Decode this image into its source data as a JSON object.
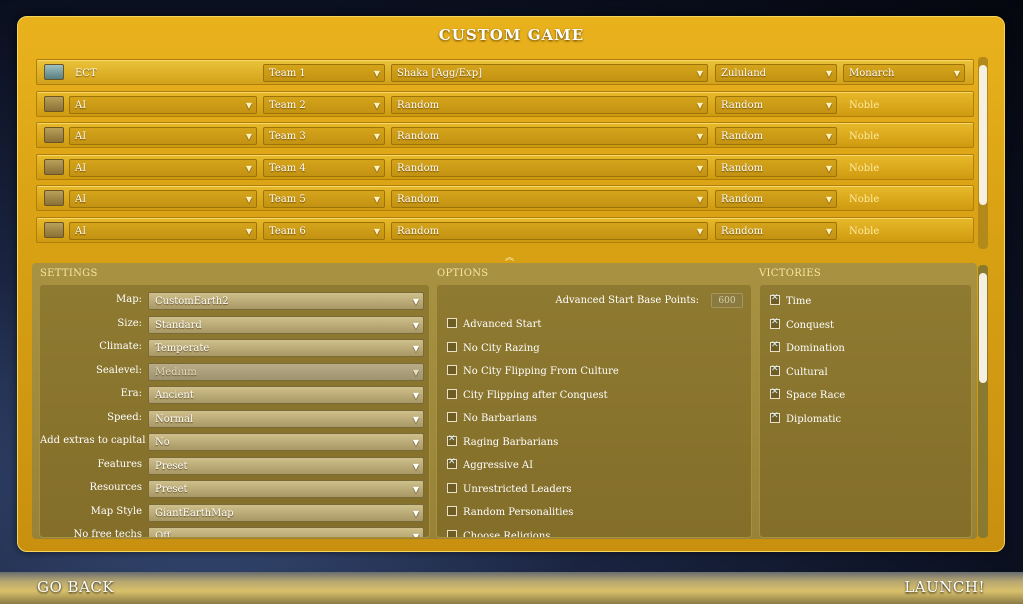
{
  "title": "CUSTOM GAME",
  "nav": {
    "back": "GO BACK",
    "launch": "LAUNCH!"
  },
  "players": [
    {
      "name": "ECT",
      "team": "Team 1",
      "leader": "Shaka [Agg/Exp]",
      "civ": "Zululand",
      "difficulty": "Monarch",
      "active": true
    },
    {
      "name": "AI",
      "team": "Team 2",
      "leader": "Random",
      "civ": "Random",
      "difficulty": "Noble",
      "active": false
    },
    {
      "name": "AI",
      "team": "Team 3",
      "leader": "Random",
      "civ": "Random",
      "difficulty": "Noble",
      "active": false
    },
    {
      "name": "AI",
      "team": "Team 4",
      "leader": "Random",
      "civ": "Random",
      "difficulty": "Noble",
      "active": false
    },
    {
      "name": "AI",
      "team": "Team 5",
      "leader": "Random",
      "civ": "Random",
      "difficulty": "Noble",
      "active": false
    },
    {
      "name": "AI",
      "team": "Team 6",
      "leader": "Random",
      "civ": "Random",
      "difficulty": "Noble",
      "active": false
    }
  ],
  "sections": {
    "settings": "SETTINGS",
    "options": "OPTIONS",
    "victories": "VICTORIES"
  },
  "settings": [
    {
      "label": "Map:",
      "value": "CustomEarth2",
      "disabled": false
    },
    {
      "label": "Size:",
      "value": "Standard",
      "disabled": false
    },
    {
      "label": "Climate:",
      "value": "Temperate",
      "disabled": false
    },
    {
      "label": "Sealevel:",
      "value": "Medium",
      "disabled": true
    },
    {
      "label": "Era:",
      "value": "Ancient",
      "disabled": false
    },
    {
      "label": "Speed:",
      "value": "Normal",
      "disabled": false
    },
    {
      "label": "Add extras to capital",
      "value": "No",
      "disabled": false
    },
    {
      "label": "Features",
      "value": "Preset",
      "disabled": false
    },
    {
      "label": "Resources",
      "value": "Preset",
      "disabled": false
    },
    {
      "label": "Map Style",
      "value": "GiantEarthMap",
      "disabled": false
    },
    {
      "label": "No free techs",
      "value": "Off",
      "disabled": false
    }
  ],
  "advanced_start": {
    "label": "Advanced Start Base Points:",
    "value": "600"
  },
  "options": [
    {
      "label": "Advanced Start",
      "checked": false
    },
    {
      "label": "No City Razing",
      "checked": false
    },
    {
      "label": "No City Flipping From Culture",
      "checked": false
    },
    {
      "label": "City Flipping after Conquest",
      "checked": false
    },
    {
      "label": "No Barbarians",
      "checked": false
    },
    {
      "label": "Raging Barbarians",
      "checked": true
    },
    {
      "label": "Aggressive AI",
      "checked": true
    },
    {
      "label": "Unrestricted Leaders",
      "checked": false
    },
    {
      "label": "Random Personalities",
      "checked": false
    },
    {
      "label": "Choose Religions",
      "checked": false
    }
  ],
  "victories": [
    {
      "label": "Time",
      "checked": true
    },
    {
      "label": "Conquest",
      "checked": true
    },
    {
      "label": "Domination",
      "checked": true
    },
    {
      "label": "Cultural",
      "checked": true
    },
    {
      "label": "Space Race",
      "checked": true
    },
    {
      "label": "Diplomatic",
      "checked": true
    }
  ],
  "colors": {
    "panel": "#d9a113",
    "row": "#cf9a10",
    "lower": "#978338"
  }
}
